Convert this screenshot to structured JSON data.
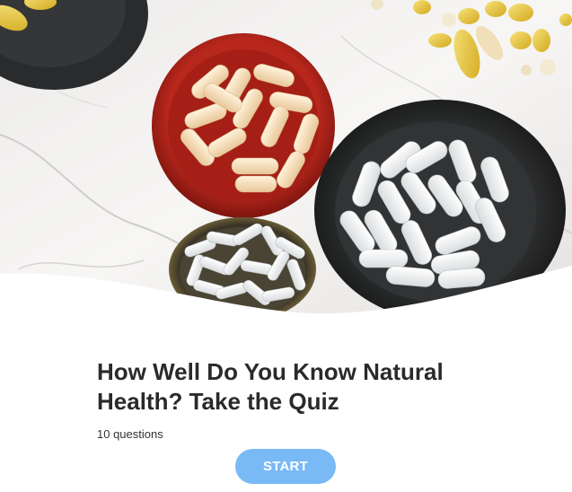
{
  "hero": {
    "image_name": "bowls-of-supplement-capsules-photo"
  },
  "quiz": {
    "title": "How Well Do You Know Natural Health? Take the Quiz",
    "question_count": "10 questions",
    "start_label": "START"
  },
  "colors": {
    "start_button": "#78b9f6",
    "title_text": "#2a2a2a",
    "background": "#ffffff"
  }
}
